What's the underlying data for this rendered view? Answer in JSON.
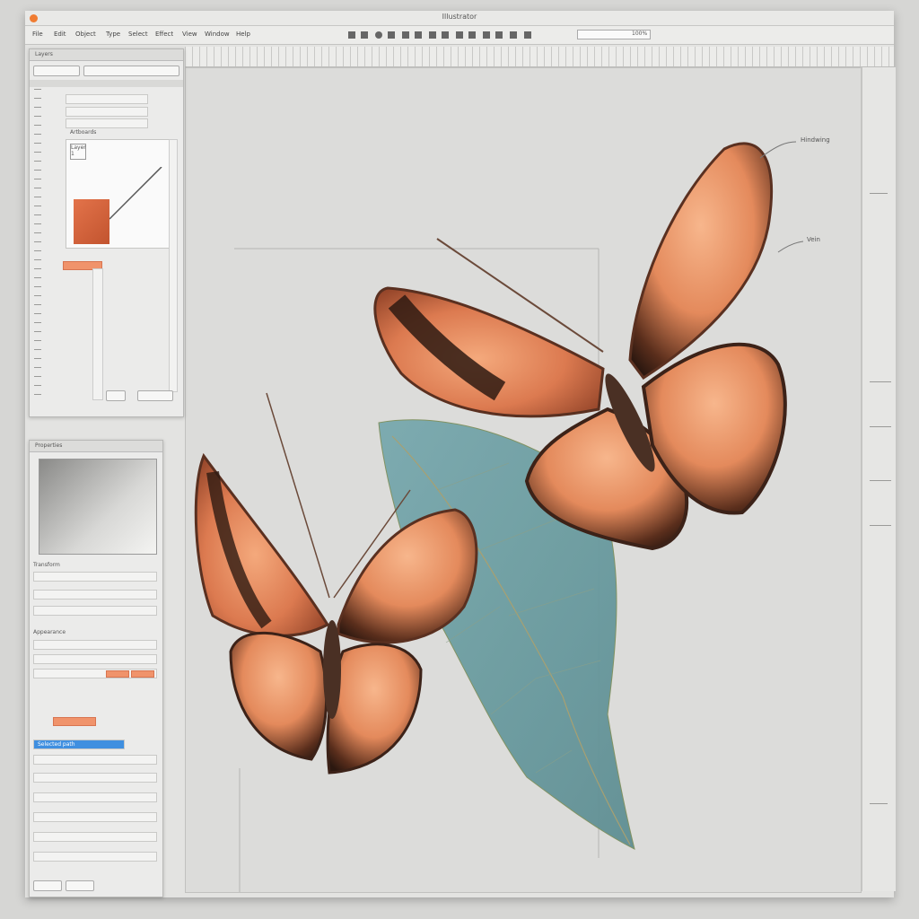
{
  "window": {
    "title": "Illustrator"
  },
  "toolbar": {
    "items": [
      "File",
      "Edit",
      "Object",
      "Type",
      "Select",
      "Effect",
      "View",
      "Window",
      "Help"
    ],
    "zoom_label": "100%"
  },
  "layers_panel": {
    "title": "Layers",
    "header_label": "Artboards",
    "preview_label": "Layer preview",
    "preview_tag": "Layer 1"
  },
  "tools_panel": {
    "title": "Properties",
    "transform_label": "Transform",
    "appearance_label": "Appearance",
    "selected_row_label": "Selected path"
  },
  "canvas": {
    "annotations": {
      "top_label": "Hindwing",
      "mid_label": "Vein"
    }
  },
  "colors": {
    "accent": "#3f8fe0",
    "highlight": "#f0936b",
    "wing_orange": "#e98a5c",
    "wing_dark": "#3a2218",
    "leaf_teal": "#6c9ea3"
  },
  "icons": [
    "close-icon",
    "pen-icon",
    "arrow-icon",
    "hand-icon",
    "zoom-icon",
    "eye-icon",
    "lock-icon"
  ]
}
